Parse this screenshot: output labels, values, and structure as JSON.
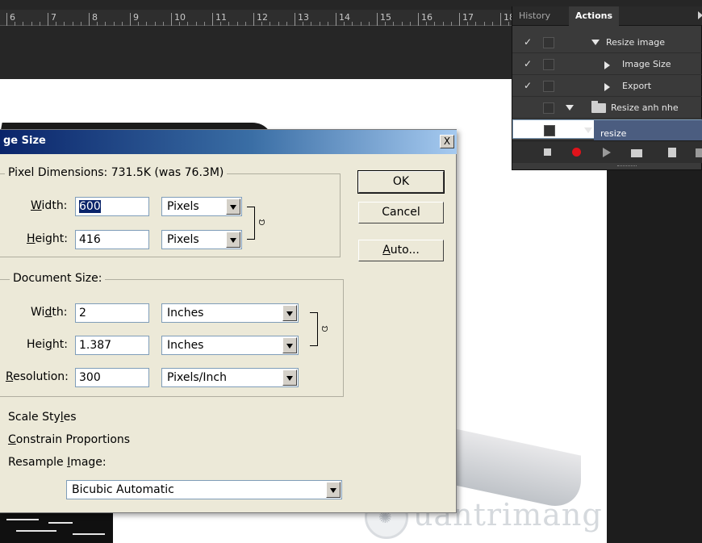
{
  "ruler": {
    "numbers": [
      "6",
      "7",
      "8",
      "9",
      "10",
      "11",
      "12",
      "13",
      "14",
      "15",
      "16",
      "17",
      "18"
    ]
  },
  "panel": {
    "tabs": [
      {
        "label": "History",
        "active": false
      },
      {
        "label": "Actions",
        "active": true
      }
    ],
    "actions": [
      {
        "label": "Resize image",
        "checked": true,
        "expand": "down",
        "kind": "set"
      },
      {
        "label": "Image Size",
        "checked": true,
        "expand": "right",
        "kind": "step"
      },
      {
        "label": "Export",
        "checked": true,
        "expand": "right",
        "kind": "step"
      },
      {
        "label": "Resize anh nhe",
        "checked": false,
        "expand": "down",
        "kind": "folder"
      },
      {
        "label": "resize",
        "checked": false,
        "expand": "down",
        "kind": "selected"
      }
    ],
    "footer_icons": [
      "stop-icon",
      "record-icon",
      "play-icon",
      "folder-icon",
      "new-action-icon",
      "delete-icon"
    ],
    "record_color": "#e0131b"
  },
  "dialog": {
    "title": "ge Size",
    "close_label": "X",
    "pixel_dimensions_label": "Pixel Dimensions:  731.5K (was 76.3M)",
    "pixel": {
      "width_label_pre": "",
      "width_label_ul": "W",
      "width_label_post": "idth:",
      "width_value": "600",
      "width_unit": "Pixels",
      "height_label_ul": "H",
      "height_label_post": "eight:",
      "height_value": "416",
      "height_unit": "Pixels"
    },
    "document_size_label": "Document Size:",
    "doc": {
      "width_label_pre": "Wi",
      "width_label_ul": "d",
      "width_label_post": "th:",
      "width_value": "2",
      "width_unit": "Inches",
      "height_label_pre": "Hei",
      "height_label_ul": "g",
      "height_label_post": "ht:",
      "height_value": "1.387",
      "height_unit": "Inches",
      "res_label_ul": "R",
      "res_label_post": "esolution:",
      "res_value": "300",
      "res_unit": "Pixels/Inch"
    },
    "buttons": {
      "ok": "OK",
      "cancel": "Cancel",
      "auto_ul": "A",
      "auto_post": "uto..."
    },
    "options": {
      "scale_pre": "Scale Sty",
      "scale_ul": "l",
      "scale_post": "es",
      "constrain_ul": "C",
      "constrain_post": "onstrain Proportions",
      "resample_pre": "Resample ",
      "resample_ul": "I",
      "resample_post": "mage:",
      "resample_method": "Bicubic Automatic"
    }
  },
  "watermark": {
    "text": "uantrimang"
  }
}
